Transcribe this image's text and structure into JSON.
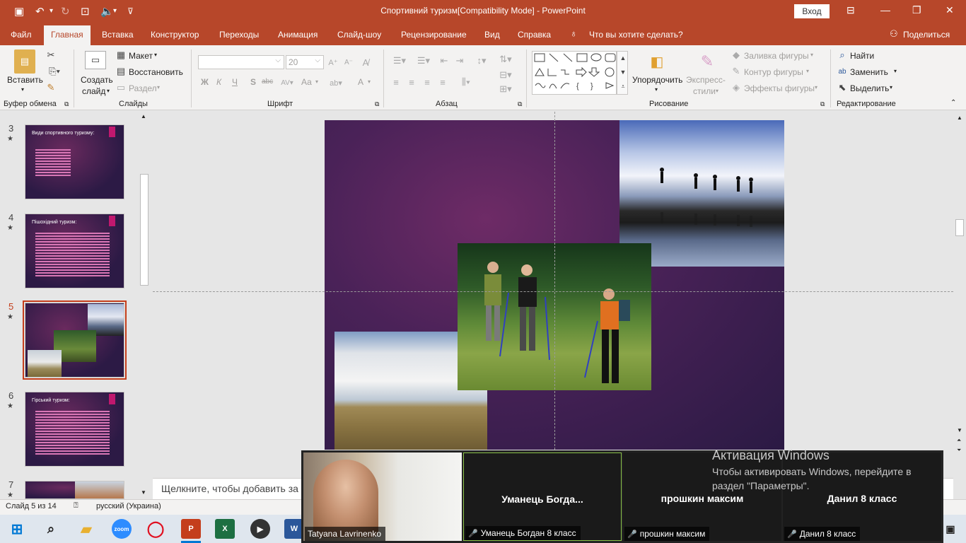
{
  "window": {
    "title": "Спортивний туризм[Compatibility Mode]  -  PowerPoint",
    "login_label": "Вход"
  },
  "ribbon_tabs": [
    {
      "label": "Файл"
    },
    {
      "label": "Главная"
    },
    {
      "label": "Вставка"
    },
    {
      "label": "Конструктор"
    },
    {
      "label": "Переходы"
    },
    {
      "label": "Анимация"
    },
    {
      "label": "Слайд-шоу"
    },
    {
      "label": "Рецензирование"
    },
    {
      "label": "Вид"
    },
    {
      "label": "Справка"
    },
    {
      "label": "Что вы хотите сделать?"
    },
    {
      "label": "Поделиться"
    }
  ],
  "ribbon": {
    "clipboard": {
      "paste": "Вставить",
      "group": "Буфер обмена"
    },
    "slides": {
      "new_slide_1": "Создать",
      "new_slide_2": "слайд",
      "layout": "Макет",
      "reset": "Восстановить",
      "section": "Раздел",
      "group": "Слайды"
    },
    "font": {
      "size": "20",
      "group": "Шрифт",
      "bold": "Ж",
      "italic": "К",
      "underline": "Ч",
      "shadow": "S",
      "strike": "abc",
      "case": "Аа",
      "color": "А"
    },
    "paragraph": {
      "group": "Абзац"
    },
    "drawing": {
      "arrange_1": "Упорядочить",
      "quick_styles_1": "Экспресс-",
      "quick_styles_2": "стили",
      "fill": "Заливка фигуры",
      "outline": "Контур фигуры",
      "effects": "Эффекты фигуры",
      "group": "Рисование"
    },
    "editing": {
      "find": "Найти",
      "replace": "Заменить",
      "select": "Выделить",
      "group": "Редактирование"
    }
  },
  "slides": [
    {
      "number": "3",
      "title": "Види спортивного туризму:"
    },
    {
      "number": "4",
      "title": "Пішохідний туризм:"
    },
    {
      "number": "5",
      "title": ""
    },
    {
      "number": "6",
      "title": "Гірський туризм:"
    },
    {
      "number": "7",
      "title": ""
    }
  ],
  "notes_placeholder": "Щелкните, чтобы добавить за",
  "status": {
    "slide_info": "Слайд 5 из 14",
    "language": "русский (Украина)"
  },
  "zoom": {
    "participants": [
      {
        "label": "Tatyana Lavrinenko",
        "display": ""
      },
      {
        "label": "Уманець Богдан 8 класс",
        "display": "Уманець  Богда..."
      },
      {
        "label": "прошкин максим",
        "display": "прошкин максим"
      },
      {
        "label": "Данил 8 класс",
        "display": "Данил 8 класс"
      }
    ]
  },
  "activation": {
    "title": "Активация Windows",
    "line1": "Чтобы активировать Windows, перейдите в",
    "line2": "раздел \"Параметры\"."
  },
  "taskbar": {
    "zoom_label": "zoom"
  },
  "colors": {
    "accent": "#b7472a",
    "slide_bg": "#3a1f50"
  }
}
